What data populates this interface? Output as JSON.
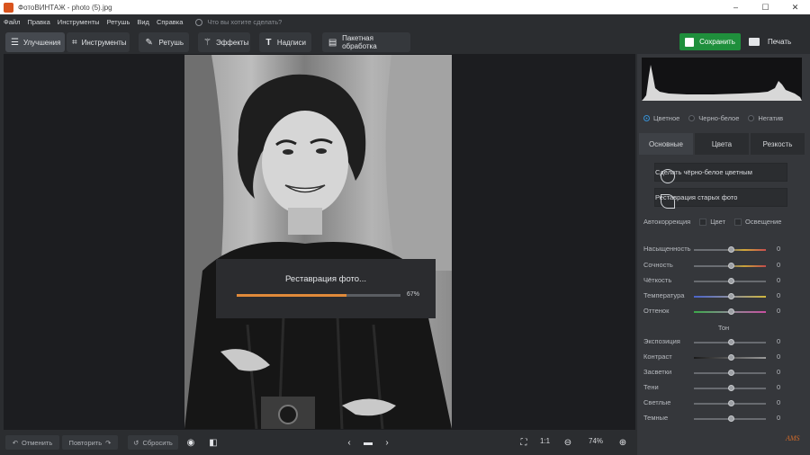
{
  "window": {
    "title": "ФотоВИНТАЖ - photo (5).jpg",
    "minimize": "–",
    "maximize": "☐",
    "close": "✕"
  },
  "menu": {
    "items": [
      "Файл",
      "Правка",
      "Инструменты",
      "Ретушь",
      "Вид",
      "Справка"
    ],
    "search_placeholder": "Что вы хотите сделать?"
  },
  "toolbar": {
    "tabs": [
      {
        "label": "Улучшения",
        "icon": "sliders-icon"
      },
      {
        "label": "Инструменты",
        "icon": "crop-icon"
      },
      {
        "label": "Ретушь",
        "icon": "brush-icon"
      },
      {
        "label": "Эффекты",
        "icon": "magic-wand-icon"
      },
      {
        "label": "Надписи",
        "icon": "text-icon"
      },
      {
        "label": "Пакетная обработка",
        "icon": "batch-icon"
      }
    ],
    "active_tab": "Улучшения",
    "save_label": "Сохранить",
    "print_label": "Печать"
  },
  "progress": {
    "title": "Реставрация фото...",
    "value": 0.67,
    "label": "67%"
  },
  "panel": {
    "modes": [
      "Цветное",
      "Черно-белое",
      "Негатив"
    ],
    "active_mode": "Цветное",
    "tabs": [
      "Основные",
      "Цвета",
      "Резкость"
    ],
    "active_tab": "Основные",
    "colorize_label": "Сделать чёрно-белое цветным",
    "restore_label": "Реставрация старых фото",
    "autocorrection_label": "Автокоррекция",
    "auto_color_label": "Цвет",
    "auto_light_label": "Освещение",
    "sliders": [
      {
        "label": "Насыщенность",
        "value": "0"
      },
      {
        "label": "Сочность",
        "value": "0"
      },
      {
        "label": "Чёткость",
        "value": "0"
      },
      {
        "label": "Температура",
        "value": "0"
      },
      {
        "label": "Оттенок",
        "value": "0"
      }
    ],
    "tone_header": "Тон",
    "tone_sliders": [
      {
        "label": "Экспозиция",
        "value": "0"
      },
      {
        "label": "Контраст",
        "value": "0"
      },
      {
        "label": "Засветки",
        "value": "0"
      },
      {
        "label": "Тени",
        "value": "0"
      },
      {
        "label": "Светлые",
        "value": "0"
      },
      {
        "label": "Темные",
        "value": "0"
      }
    ],
    "logo": "AMS"
  },
  "bottom": {
    "undo_label": "Отменить",
    "redo_label": "Повторить",
    "reset_label": "Сбросить",
    "ratio_label": "1:1",
    "zoom_label": "74%"
  },
  "colors": {
    "accent_green": "#1f8f3c",
    "progress_orange": "#e08a3a",
    "radio_blue": "#3a8fd0"
  }
}
